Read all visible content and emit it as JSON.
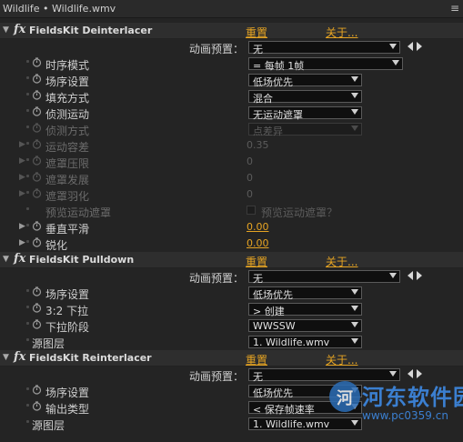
{
  "titlebar": {
    "title": "Wildlife • Wildlife.wmv",
    "menu_icon": "≡"
  },
  "fx_symbol": "fx",
  "sections": [
    {
      "name": "FieldsKit Deinterlacer",
      "reset": "重置",
      "about": "关于...",
      "preset_label": "动画预置：",
      "preset_value": "无",
      "params": [
        {
          "label": "时序模式",
          "type": "select",
          "value": "= 每帧 1帧"
        },
        {
          "label": "场序设置",
          "type": "select",
          "value": "低场优先"
        },
        {
          "label": "填充方式",
          "type": "select",
          "value": "混合"
        },
        {
          "label": "侦测运动",
          "type": "select",
          "value": "无运动遮罩"
        },
        {
          "label": "侦测方式",
          "type": "select",
          "value": "点差异",
          "disabled": true
        },
        {
          "label": "运动容差",
          "type": "number",
          "value": "0.35",
          "disabled": true
        },
        {
          "label": "遮罩压限",
          "type": "number",
          "value": "0",
          "disabled": true
        },
        {
          "label": "遮罩发展",
          "type": "number",
          "value": "0",
          "disabled": true
        },
        {
          "label": "遮罩羽化",
          "type": "number",
          "value": "0",
          "disabled": true
        },
        {
          "label": "预览运动遮罩",
          "type": "checkbox",
          "value": "预览运动遮罩？",
          "disabled": true
        },
        {
          "label": "垂直平滑",
          "type": "number",
          "value": "0.00"
        },
        {
          "label": "锐化",
          "type": "number",
          "value": "0.00"
        }
      ]
    },
    {
      "name": "FieldsKit Pulldown",
      "reset": "重置",
      "about": "关于...",
      "preset_label": "动画预置：",
      "preset_value": "无",
      "params": [
        {
          "label": "场序设置",
          "type": "select",
          "value": "低场优先"
        },
        {
          "label": "3:2 下拉",
          "type": "select",
          "value": "> 创建"
        },
        {
          "label": "下拉阶段",
          "type": "select",
          "value": "WWSSW"
        },
        {
          "label": "源图层",
          "type": "select",
          "value": "1. Wildlife.wmv"
        }
      ]
    },
    {
      "name": "FieldsKit Reinterlacer",
      "reset": "重置",
      "about": "关于...",
      "preset_label": "动画预置：",
      "preset_value": "无",
      "params": [
        {
          "label": "场序设置",
          "type": "select",
          "value": "低场优先"
        },
        {
          "label": "输出类型",
          "type": "select",
          "value": "< 保存帧速率"
        },
        {
          "label": "源图层",
          "type": "select",
          "value": "1. Wildlife.wmv"
        }
      ]
    }
  ],
  "watermark": {
    "name": "河东软件园",
    "url": "www.pc0359.cn",
    "logo_letter": "河"
  },
  "colors": {
    "link": "#e6a423",
    "background": "#242424",
    "watermark": "#3b7fd0"
  }
}
